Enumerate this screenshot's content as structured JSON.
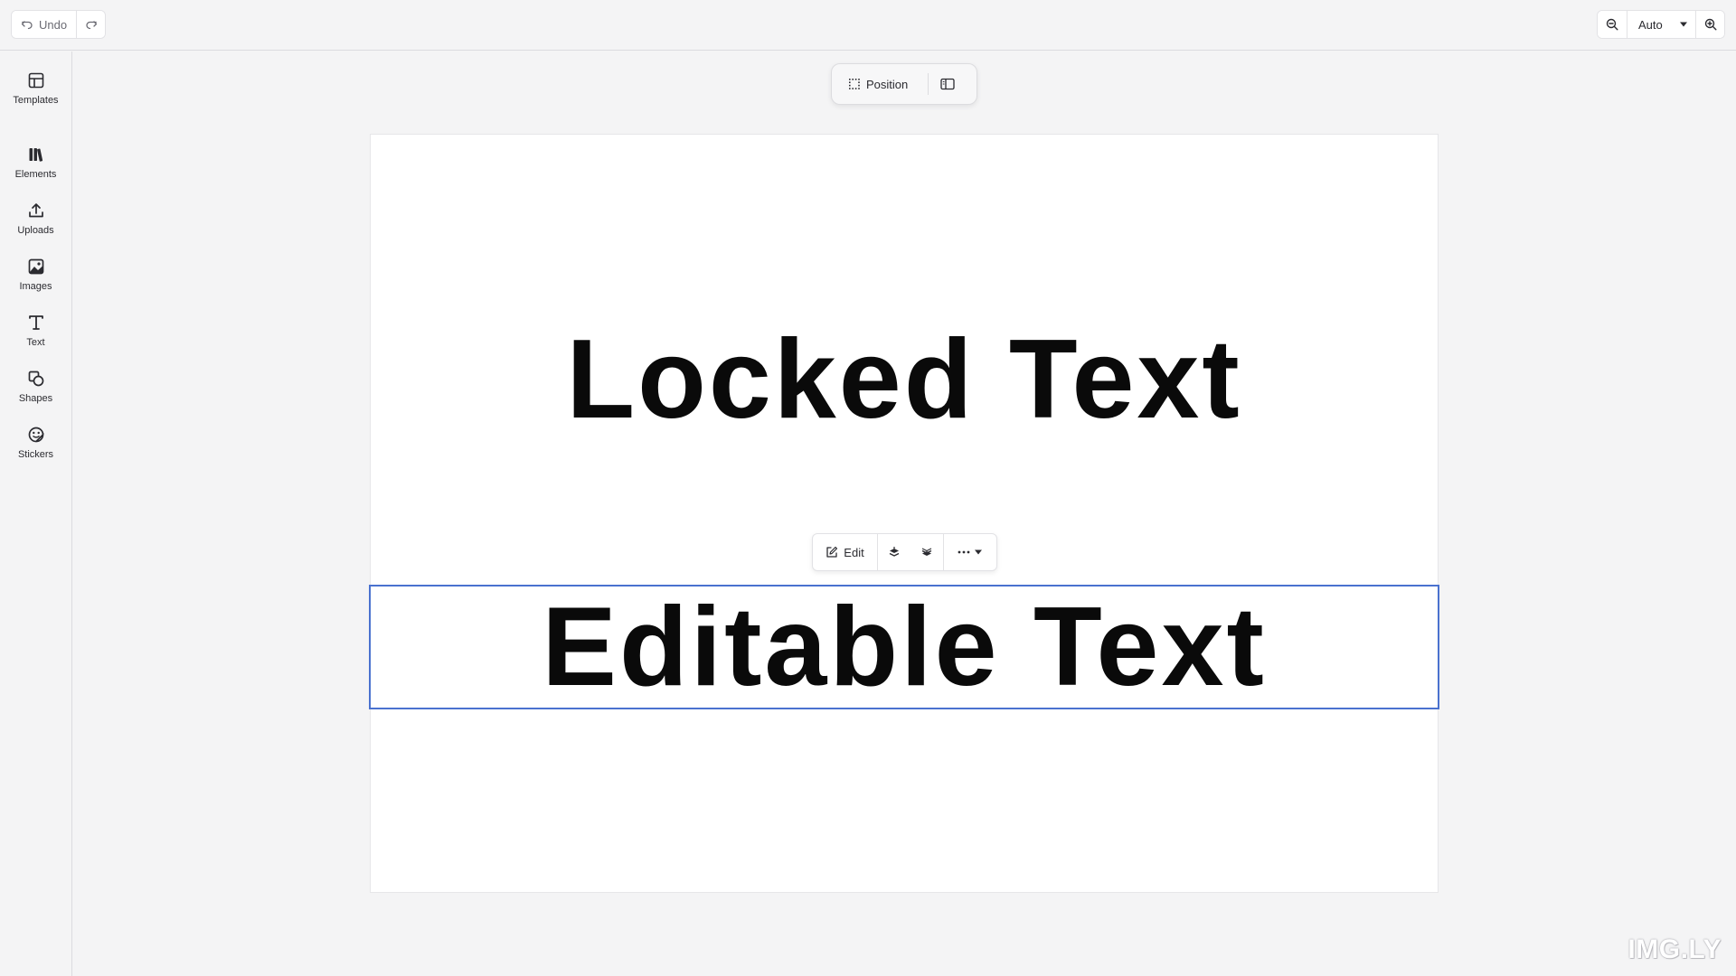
{
  "toolbar": {
    "undo_label": "Undo",
    "zoom_value": "Auto"
  },
  "sidebar": {
    "items": [
      {
        "label": "Templates",
        "icon": "templates-icon"
      },
      {
        "label": "Elements",
        "icon": "elements-icon"
      },
      {
        "label": "Uploads",
        "icon": "upload-icon"
      },
      {
        "label": "Images",
        "icon": "image-icon"
      },
      {
        "label": "Text",
        "icon": "text-icon"
      },
      {
        "label": "Shapes",
        "icon": "shapes-icon"
      },
      {
        "label": "Stickers",
        "icon": "sticker-icon"
      }
    ]
  },
  "canvas_toolbar": {
    "position_label": "Position"
  },
  "canvas": {
    "locked_text": "Locked Text",
    "editable_text": "Editable Text"
  },
  "context_menu": {
    "edit_label": "Edit"
  },
  "watermark": "IMG.LY",
  "colors": {
    "selection": "#4a72cf",
    "background": "#f4f4f5",
    "page": "#ffffff"
  }
}
